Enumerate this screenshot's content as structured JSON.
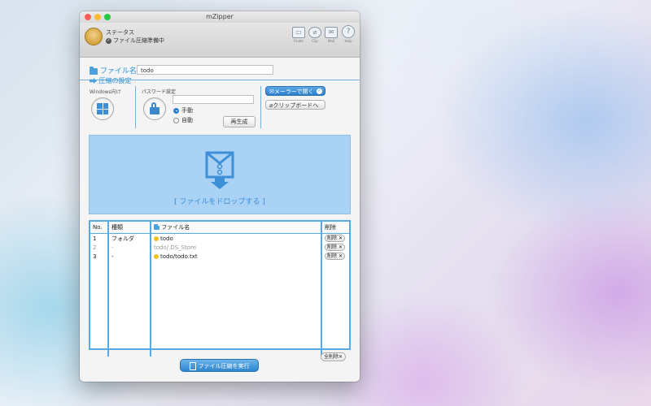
{
  "window": {
    "title": "mZipper"
  },
  "status": {
    "title": "ステータス",
    "value": "ファイル圧縮準備中"
  },
  "toolbar": {
    "buttons": [
      {
        "icon": "window-icon",
        "label": "Finder"
      },
      {
        "icon": "paperclip-icon",
        "label": "Clip"
      },
      {
        "icon": "mail-icon",
        "label": "Mail"
      },
      {
        "icon": "help-icon",
        "label": "Help"
      }
    ]
  },
  "filename": {
    "label": "ファイル名:",
    "value": "todo"
  },
  "settings": {
    "heading": "圧縮の設定",
    "windows_label": "Windows向け",
    "password_label": "パスワード設定",
    "radio_manual": "手動",
    "radio_auto": "自動",
    "regenerate": "再生成",
    "open_mailer": "メーラーで開く",
    "to_clipboard": "クリップボードへ"
  },
  "dropzone": {
    "text": "[ ファイルをドロップする ]"
  },
  "table": {
    "headers": {
      "no": "No.",
      "type": "種類",
      "name": "ファイル名",
      "delete": "削除"
    },
    "rows": [
      {
        "no": "1",
        "type": "フォルダ",
        "name": "todo",
        "delete": "削除"
      },
      {
        "no": "2",
        "type": "-",
        "name": "todo/.DS_Store",
        "delete": "削除"
      },
      {
        "no": "3",
        "type": "-",
        "name": "todo/todo.txt",
        "delete": "削除"
      }
    ]
  },
  "clear_all": "全削除",
  "run_button": "ファイル圧縮を実行",
  "colors": {
    "accent": "#2a8fd8",
    "dropzone": "#a9d2f4"
  }
}
